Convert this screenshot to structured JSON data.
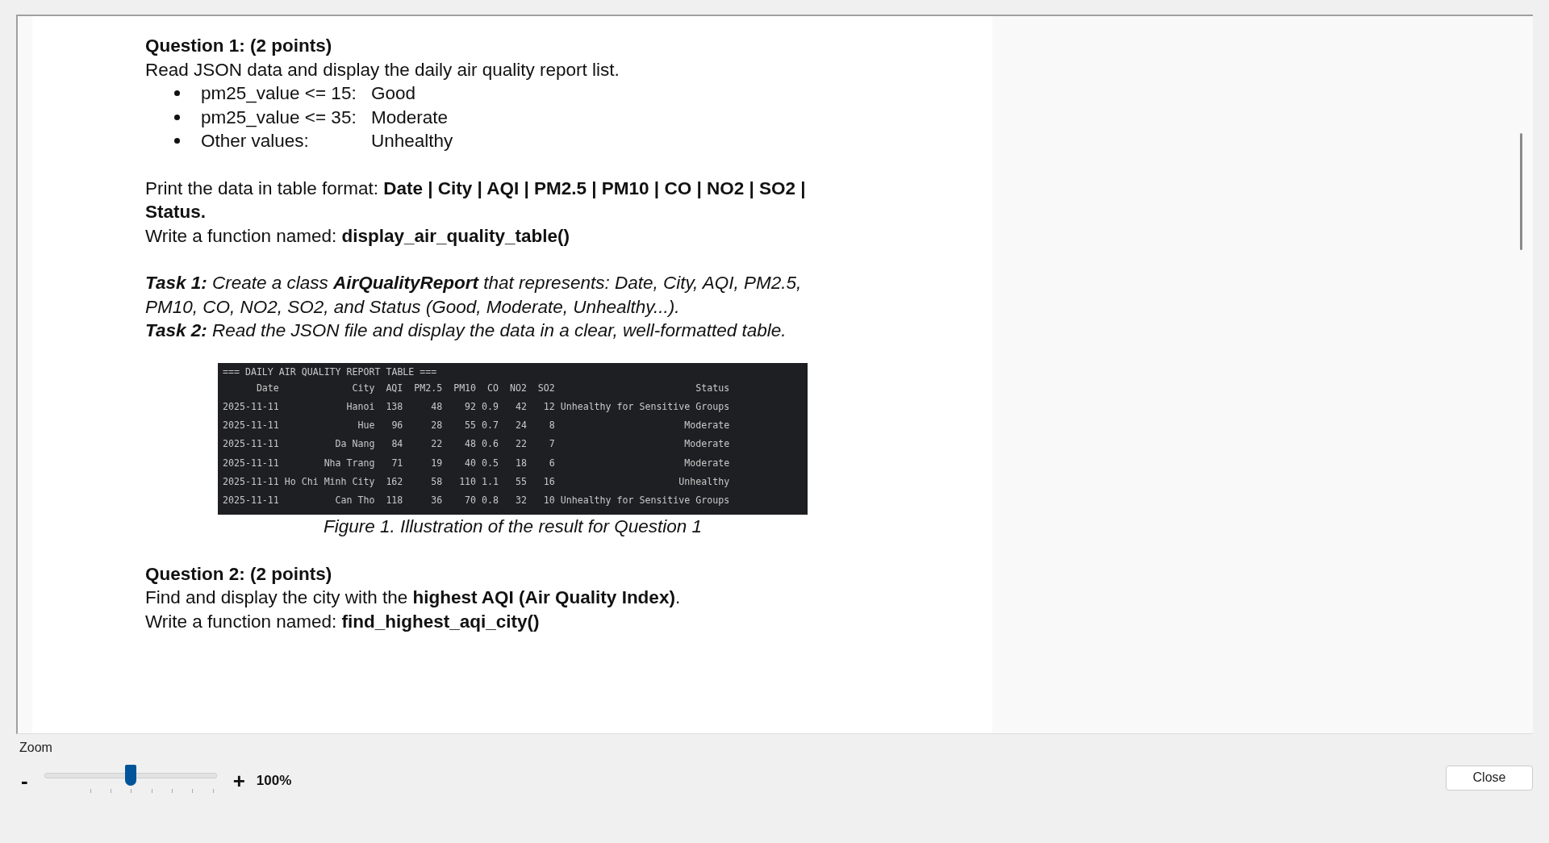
{
  "document": {
    "q1_title": "Question 1: (2 points)",
    "q1_intro": "Read JSON data and display the daily air quality report list.",
    "rules": [
      {
        "condition": "pm25_value <= 15:",
        "result": "Good"
      },
      {
        "condition": "pm25_value <= 35:",
        "result": "Moderate"
      },
      {
        "condition": "Other values:",
        "result": "Unhealthy"
      }
    ],
    "q1_format": "Print the data in table format: **Date | City | AQI | PM2.5 | PM10 | CO | NO2 | SO2 | Status.**",
    "q1_function": "Write a function named: **display_air_quality_table()**",
    "tasks": [
      "**Task 1:** Create a class **AirQualityReport** that represents: Date, City, AQI, PM2.5, PM10, CO, NO2, SO2, and Status (Good, Moderate, Unhealthy...).",
      "**Task 2:** Read the JSON file and display the data in a clear, well-formatted table."
    ],
    "figure": {
      "title": "=== DAILY AIR QUALITY REPORT TABLE ===",
      "columns": [
        "Date",
        "City",
        "AQI",
        "PM2.5",
        "PM10",
        "CO",
        "NO2",
        "SO2",
        "Status"
      ],
      "rows": [
        [
          "2025-11-11",
          "Hanoi",
          "138",
          "48",
          "92",
          "0.9",
          "42",
          "12",
          "Unhealthy for Sensitive Groups"
        ],
        [
          "2025-11-11",
          "Hue",
          "96",
          "28",
          "55",
          "0.7",
          "24",
          "8",
          "Moderate"
        ],
        [
          "2025-11-11",
          "Da Nang",
          "84",
          "22",
          "48",
          "0.6",
          "22",
          "7",
          "Moderate"
        ],
        [
          "2025-11-11",
          "Nha Trang",
          "71",
          "19",
          "40",
          "0.5",
          "18",
          "6",
          "Moderate"
        ],
        [
          "2025-11-11",
          "Ho Chi Minh City",
          "162",
          "58",
          "110",
          "1.1",
          "55",
          "16",
          "Unhealthy"
        ],
        [
          "2025-11-11",
          "Can Tho",
          "118",
          "36",
          "70",
          "0.8",
          "32",
          "10",
          "Unhealthy for Sensitive Groups"
        ]
      ],
      "caption": "Figure 1. Illustration of the result for Question 1"
    },
    "q2_title": "Question 2: (2 points)",
    "q2_intro": "Find and display the city with the **highest AQI (Air Quality Index)**.",
    "q2_function": "Write a function named: **find_highest_aqi_city()**"
  },
  "zoom": {
    "label": "Zoom",
    "minus": "-",
    "plus": "+",
    "level": 0.5,
    "value": "100%"
  },
  "buttons": [
    "Close"
  ]
}
